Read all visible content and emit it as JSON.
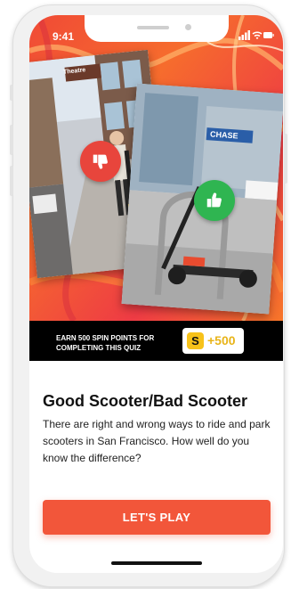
{
  "status_bar": {
    "time": "9:41"
  },
  "hero": {
    "street_sign": "Theatre",
    "building_sign": "CHASE"
  },
  "banner": {
    "text": "EARN 500 SPIN POINTS FOR COMPLETING THIS QUIZ",
    "logo_letter": "S",
    "points": "+500"
  },
  "quiz": {
    "title": "Good Scooter/Bad Scooter",
    "description": "There are right and wrong ways to ride and park scooters in San Francisco. How well do you know the difference?",
    "cta_label": "LET'S PLAY"
  },
  "colors": {
    "accent": "#f2563a",
    "thumbs_down": "#e8453c",
    "thumbs_up": "#2fb551",
    "points_gold": "#e8b419"
  }
}
